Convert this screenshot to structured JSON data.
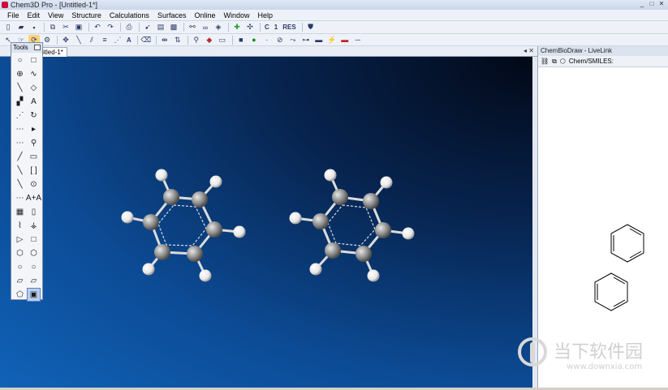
{
  "window": {
    "title": "Chem3D Pro - [Untitled-1*]",
    "controls": [
      "_",
      "□",
      "✕"
    ]
  },
  "menu": [
    "File",
    "Edit",
    "View",
    "Structure",
    "Calculations",
    "Surfaces",
    "Online",
    "Window",
    "Help"
  ],
  "toolbar_text": {
    "c_button": "C",
    "one_button": "1",
    "res_button": "RES"
  },
  "document_tab": {
    "label": "itled-1*",
    "nav": "◂ ✕"
  },
  "tools_palette": {
    "title": "Tools",
    "tool_glyphs": [
      "○",
      "□",
      "⊕",
      "∿",
      "╲",
      "◇",
      "▞",
      "A",
      "⋰",
      "↻",
      "⋯",
      "▸",
      "⋯",
      "⚲",
      "╱",
      "▭",
      "╲",
      "[ ]",
      "╲",
      "⊙",
      "⋯",
      "A+A",
      "▦",
      "▯",
      "⌇",
      "⚶",
      "▷",
      "□",
      "⬡",
      "⬡",
      "○",
      "○",
      "▱",
      "▱",
      "⬠",
      "▣"
    ]
  },
  "side_panel": {
    "title": "ChemBioDraw - LiveLink",
    "toolbar_label": "Chem/SMILES:"
  },
  "watermark": {
    "cn": "当下软件园",
    "url": "www.downxia.com"
  },
  "colors": {
    "carbon": "#8e8e8e",
    "hydrogen": "#f2f2f2",
    "canvas_dark": "#020816",
    "canvas_light": "#1062b8"
  }
}
